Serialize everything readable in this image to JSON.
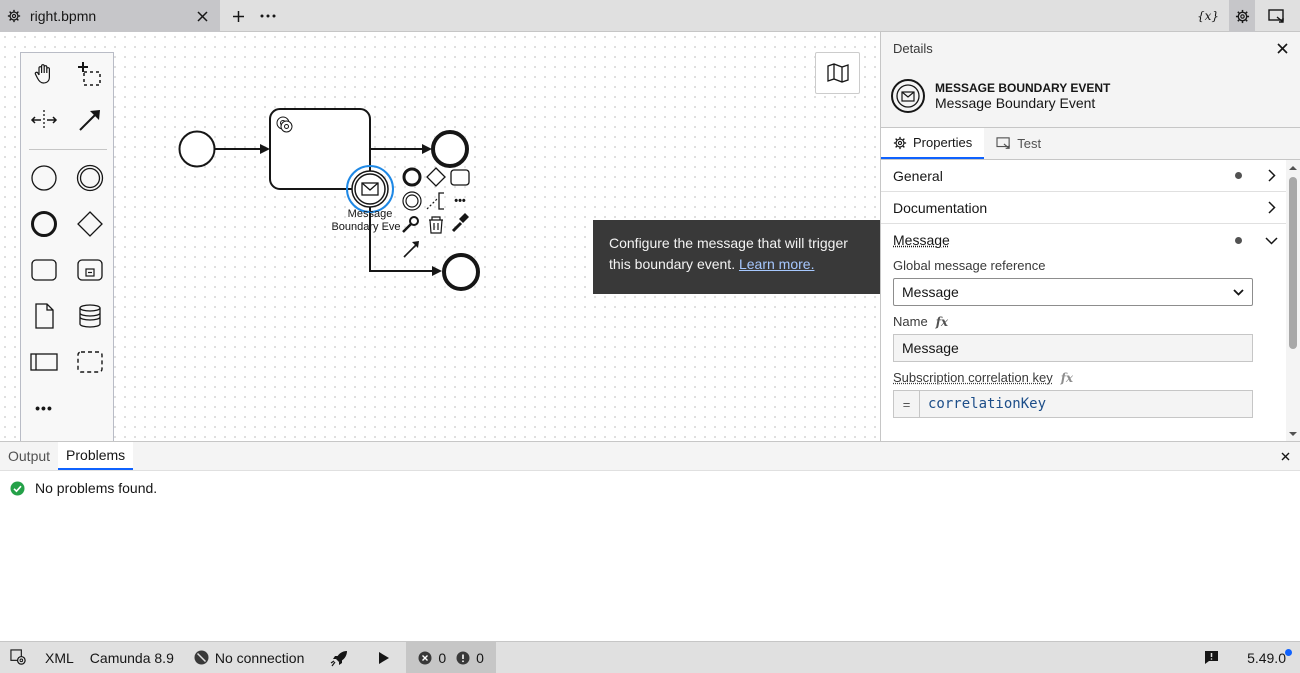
{
  "tabbar": {
    "file_tab": {
      "title": "right.bpmn",
      "icon": "gear-icon"
    },
    "add_tab_icon": "plus-icon",
    "more_icon": "overflow-icon",
    "right_icons": [
      "variables-icon",
      "gear-icon",
      "deploy-window-icon"
    ],
    "variables_label": "{x}"
  },
  "canvas": {
    "palette": [
      "hand-tool",
      "lasso-tool",
      "space-tool",
      "connect-tool",
      "start-event",
      "intermediate-event",
      "end-event",
      "gateway",
      "task",
      "subprocess",
      "data-object",
      "data-store",
      "participant",
      "group",
      "more-tools"
    ],
    "more_tools_label": "•••",
    "element_label_line1": "Message",
    "element_label_line2": "Boundary Eve",
    "context_pad_more": "•••",
    "tooltip": {
      "text": "Configure the message that will trigger this boundary event.",
      "link": "Learn more."
    }
  },
  "panel": {
    "header": "Details",
    "element_type": "MESSAGE BOUNDARY EVENT",
    "element_name": "Message Boundary Event",
    "tabs": {
      "properties": "Properties",
      "test": "Test"
    },
    "groups": {
      "general": "General",
      "documentation": "Documentation",
      "message": "Message"
    },
    "fields": {
      "global_ref_label": "Global message reference",
      "global_ref_value": "Message",
      "name_label": "Name",
      "name_value": "Message",
      "corr_label": "Subscription correlation key",
      "corr_value": "correlationKey",
      "fx": "fx",
      "feel_eq": "="
    }
  },
  "bottom": {
    "tabs": {
      "output": "Output",
      "problems": "Problems"
    },
    "problems_message": "No problems found."
  },
  "statusbar": {
    "xml": "XML",
    "engine": "Camunda 8.9",
    "connection": "No connection",
    "errors": "0",
    "warnings": "0",
    "version": "5.49.0"
  },
  "colors": {
    "accent": "#0f62fe",
    "selection": "#1e88e5",
    "success": "#24a148",
    "tooltip_bg": "#393939"
  }
}
